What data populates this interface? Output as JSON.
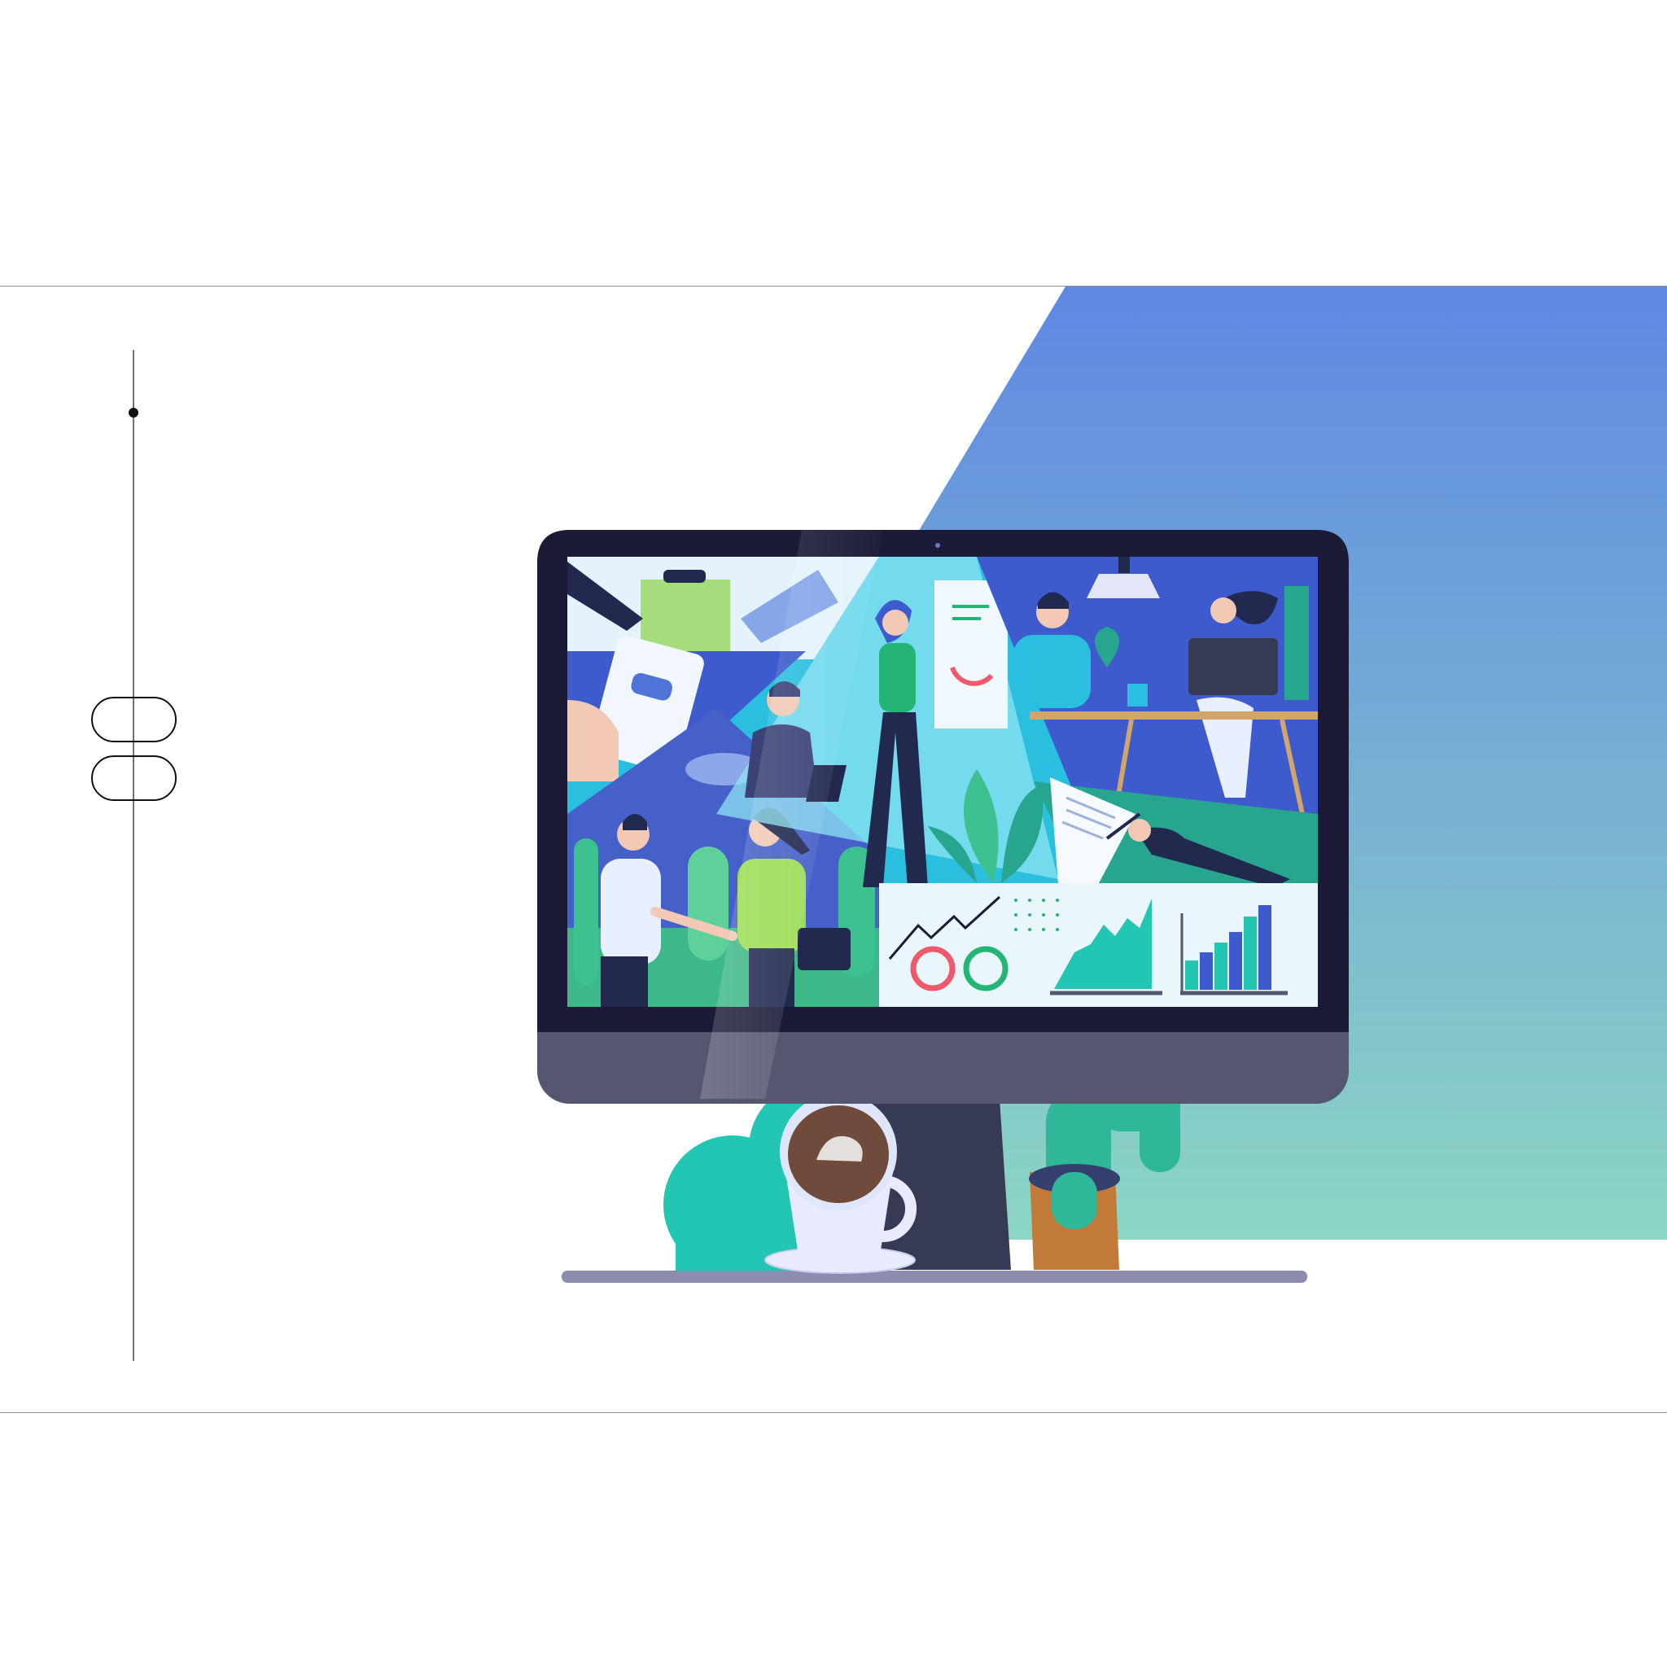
{
  "colors": {
    "gradient_top": "#5f88e3",
    "gradient_bottom": "#8cd6c4",
    "monitor_bezel": "#1b1b38",
    "monitor_chin": "#555770",
    "stand": "#373a54",
    "desk": "#8c8cae",
    "cactus": "#2fb79a",
    "bush": "#22c6b2",
    "screen_sky": "#2bbfdf",
    "accent_red": "#f0586b",
    "accent_green": "#22b573",
    "accent_blue": "#3d5bcc"
  },
  "scene": {
    "decor_icons": [
      "vertical-guide-line",
      "timeline-dot",
      "pill-outline-icon",
      "pill-outline-icon"
    ],
    "objects": [
      "monitor",
      "coffee-cup",
      "cactus-pot",
      "bush",
      "desk-shelf"
    ],
    "screen_panels": [
      "handover-of-documents",
      "phone-in-hand",
      "handshake-meeting",
      "presentation-on-flipchart",
      "office-workers-at-desks",
      "contract-signing",
      "analytics-dashboard"
    ]
  }
}
